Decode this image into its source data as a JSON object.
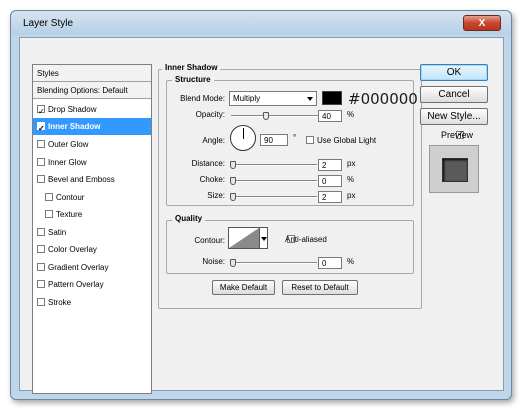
{
  "window": {
    "title": "Layer Style",
    "close_label": "X"
  },
  "styles_list": {
    "header": "Styles",
    "blending": "Blending Options: Default",
    "items": [
      {
        "label": "Drop Shadow",
        "checked": true
      },
      {
        "label": "Inner Shadow",
        "checked": true,
        "selected": true
      },
      {
        "label": "Outer Glow",
        "checked": false
      },
      {
        "label": "Inner Glow",
        "checked": false
      },
      {
        "label": "Bevel and Emboss",
        "checked": false
      },
      {
        "label": "Contour",
        "checked": false
      },
      {
        "label": "Texture",
        "checked": false
      },
      {
        "label": "Satin",
        "checked": false
      },
      {
        "label": "Color Overlay",
        "checked": false
      },
      {
        "label": "Gradient Overlay",
        "checked": false
      },
      {
        "label": "Pattern Overlay",
        "checked": false
      },
      {
        "label": "Stroke",
        "checked": false
      }
    ]
  },
  "panel": {
    "title": "Inner Shadow",
    "structure": {
      "title": "Structure",
      "blend_mode_label": "Blend Mode:",
      "blend_mode_value": "Multiply",
      "color_hex": "#000000",
      "color_swatch": "#000000",
      "opacity_label": "Opacity:",
      "opacity_value": "40",
      "opacity_fraction": 0.4,
      "percent": "%",
      "angle_label": "Angle:",
      "angle_value": "90",
      "degree": "°",
      "global_light_label": "Use Global Light",
      "distance_label": "Distance:",
      "distance_value": "2",
      "choke_label": "Choke:",
      "choke_value": "0",
      "size_label": "Size:",
      "size_value": "2",
      "px": "px"
    },
    "quality": {
      "title": "Quality",
      "contour_label": "Contour:",
      "anti_aliased_label": "Anti-aliased",
      "noise_label": "Noise:",
      "noise_value": "0",
      "percent": "%"
    },
    "make_default": "Make Default",
    "reset_default": "Reset to Default"
  },
  "buttons": {
    "ok": "OK",
    "cancel": "Cancel",
    "new_style": "New Style...",
    "preview_label": "Preview",
    "preview_checked": true
  }
}
